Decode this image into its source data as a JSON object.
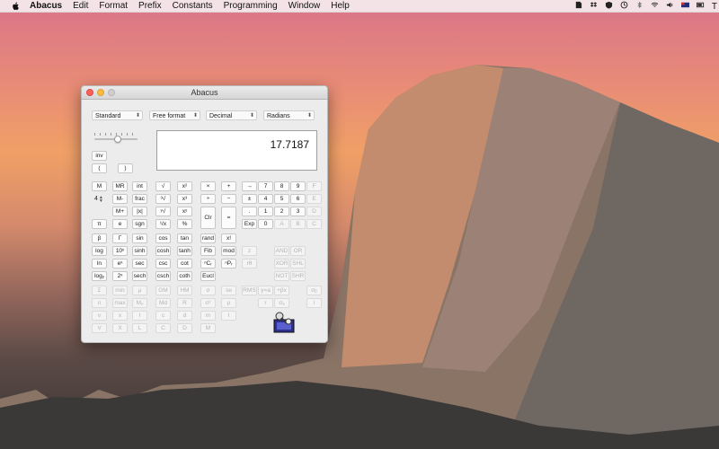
{
  "menubar": {
    "apple_icon": "apple-icon",
    "items": [
      "Abacus",
      "Edit",
      "Format",
      "Prefix",
      "Constants",
      "Programming",
      "Window",
      "Help"
    ],
    "tray_icons": [
      "evernote-icon",
      "dropbox-icon",
      "security-icon",
      "time-machine-icon",
      "bluetooth-icon",
      "wifi-icon",
      "volume-icon",
      "flag-icon",
      "battery-icon"
    ],
    "tray_text": "T"
  },
  "window": {
    "title": "Abacus",
    "dropdowns": [
      "Standard",
      "Free format",
      "Decimal",
      "Radians"
    ],
    "display_value": "17.7187",
    "memory_counter": "4"
  },
  "buttons": [
    {
      "label": "inv",
      "enabled": true
    },
    {
      "label": "(",
      "enabled": true
    },
    {
      "label": ")",
      "enabled": true
    },
    {
      "label": "M",
      "enabled": true
    },
    {
      "label": "MR",
      "enabled": true
    },
    {
      "label": "int",
      "enabled": true
    },
    {
      "label": "√",
      "enabled": true
    },
    {
      "label": "x²",
      "enabled": true
    },
    {
      "label": "×",
      "enabled": true
    },
    {
      "label": "+",
      "enabled": true
    },
    {
      "label": "→",
      "enabled": true
    },
    {
      "label": "7",
      "enabled": true
    },
    {
      "label": "8",
      "enabled": true
    },
    {
      "label": "9",
      "enabled": true
    },
    {
      "label": "F",
      "enabled": false
    },
    {
      "label": "M-",
      "enabled": true
    },
    {
      "label": "frac",
      "enabled": true
    },
    {
      "label": "³√",
      "enabled": true
    },
    {
      "label": "x³",
      "enabled": true
    },
    {
      "label": "÷",
      "enabled": true
    },
    {
      "label": "−",
      "enabled": true
    },
    {
      "label": "±",
      "enabled": true
    },
    {
      "label": "4",
      "enabled": true
    },
    {
      "label": "5",
      "enabled": true
    },
    {
      "label": "6",
      "enabled": true
    },
    {
      "label": "E",
      "enabled": false
    },
    {
      "label": "M+",
      "enabled": true
    },
    {
      "label": "|x|",
      "enabled": true
    },
    {
      "label": "ʸ√",
      "enabled": true
    },
    {
      "label": "xʸ",
      "enabled": true
    },
    {
      "label": "Clr",
      "enabled": true
    },
    {
      "label": "=",
      "enabled": true
    },
    {
      "label": ".",
      "enabled": true
    },
    {
      "label": "1",
      "enabled": true
    },
    {
      "label": "2",
      "enabled": true
    },
    {
      "label": "3",
      "enabled": true
    },
    {
      "label": "D",
      "enabled": false
    },
    {
      "label": "π",
      "enabled": true
    },
    {
      "label": "e",
      "enabled": true
    },
    {
      "label": "sgn",
      "enabled": true
    },
    {
      "label": "¹/x",
      "enabled": true
    },
    {
      "label": "%",
      "enabled": true
    },
    {
      "label": "Exp",
      "enabled": true
    },
    {
      "label": "0",
      "enabled": true
    },
    {
      "label": "A",
      "enabled": false
    },
    {
      "label": "B",
      "enabled": false
    },
    {
      "label": "C",
      "enabled": false
    },
    {
      "label": "β",
      "enabled": true
    },
    {
      "label": "Γ",
      "enabled": true
    },
    {
      "label": "sin",
      "enabled": true
    },
    {
      "label": "cos",
      "enabled": true
    },
    {
      "label": "tan",
      "enabled": true
    },
    {
      "label": "rand",
      "enabled": true
    },
    {
      "label": "x!",
      "enabled": true
    },
    {
      "label": "log",
      "enabled": true
    },
    {
      "label": "10ˣ",
      "enabled": true
    },
    {
      "label": "sinh",
      "enabled": true
    },
    {
      "label": "cosh",
      "enabled": true
    },
    {
      "label": "tanh",
      "enabled": true
    },
    {
      "label": "Fib",
      "enabled": true
    },
    {
      "label": "mod",
      "enabled": true
    },
    {
      "label": "z",
      "enabled": false
    },
    {
      "label": "AND",
      "enabled": false
    },
    {
      "label": "OR",
      "enabled": false
    },
    {
      "label": "ln",
      "enabled": true
    },
    {
      "label": "eˣ",
      "enabled": true
    },
    {
      "label": "sec",
      "enabled": true
    },
    {
      "label": "csc",
      "enabled": true
    },
    {
      "label": "cot",
      "enabled": true
    },
    {
      "label": "ⁿCᵣ",
      "enabled": true
    },
    {
      "label": "ⁿPᵣ",
      "enabled": true
    },
    {
      "label": "rθ",
      "enabled": false
    },
    {
      "label": "XOR",
      "enabled": false
    },
    {
      "label": "SHL",
      "enabled": false
    },
    {
      "label": "logᵧ",
      "enabled": true
    },
    {
      "label": "2ˣ",
      "enabled": true
    },
    {
      "label": "sech",
      "enabled": true
    },
    {
      "label": "csch",
      "enabled": true
    },
    {
      "label": "coth",
      "enabled": true
    },
    {
      "label": "Eucl",
      "enabled": true
    },
    {
      "label": "NOT",
      "enabled": false
    },
    {
      "label": "SHR",
      "enabled": false
    },
    {
      "label": "Σ",
      "enabled": false
    },
    {
      "label": "min",
      "enabled": false
    },
    {
      "label": "μ",
      "enabled": false
    },
    {
      "label": "GM",
      "enabled": false
    },
    {
      "label": "HM",
      "enabled": false
    },
    {
      "label": "σ",
      "enabled": false
    },
    {
      "label": "se",
      "enabled": false
    },
    {
      "label": "RMS",
      "enabled": false
    },
    {
      "label": "y=a",
      "enabled": false
    },
    {
      "label": "+βx",
      "enabled": false
    },
    {
      "label": "σᵦ",
      "enabled": false
    },
    {
      "label": "n",
      "enabled": false
    },
    {
      "label": "max",
      "enabled": false
    },
    {
      "label": "Mₒ",
      "enabled": false
    },
    {
      "label": "Md",
      "enabled": false
    },
    {
      "label": "R",
      "enabled": false
    },
    {
      "label": "σ²",
      "enabled": false
    },
    {
      "label": "ρ",
      "enabled": false
    },
    {
      "label": "r",
      "enabled": false
    },
    {
      "label": "σₐ",
      "enabled": false
    },
    {
      "label": "i",
      "enabled": false
    },
    {
      "label": "v",
      "enabled": false
    },
    {
      "label": "x",
      "enabled": false
    },
    {
      "label": "l",
      "enabled": false
    },
    {
      "label": "c",
      "enabled": false
    },
    {
      "label": "d",
      "enabled": false
    },
    {
      "label": "m",
      "enabled": false
    },
    {
      "label": "I",
      "enabled": false
    },
    {
      "label": "V",
      "enabled": false
    },
    {
      "label": "X",
      "enabled": false
    },
    {
      "label": "L",
      "enabled": false
    },
    {
      "label": "C",
      "enabled": false
    },
    {
      "label": "D",
      "enabled": false
    },
    {
      "label": "M",
      "enabled": false
    }
  ],
  "colors": {
    "accent": "#fc605c",
    "window_bg": "#ececec"
  }
}
